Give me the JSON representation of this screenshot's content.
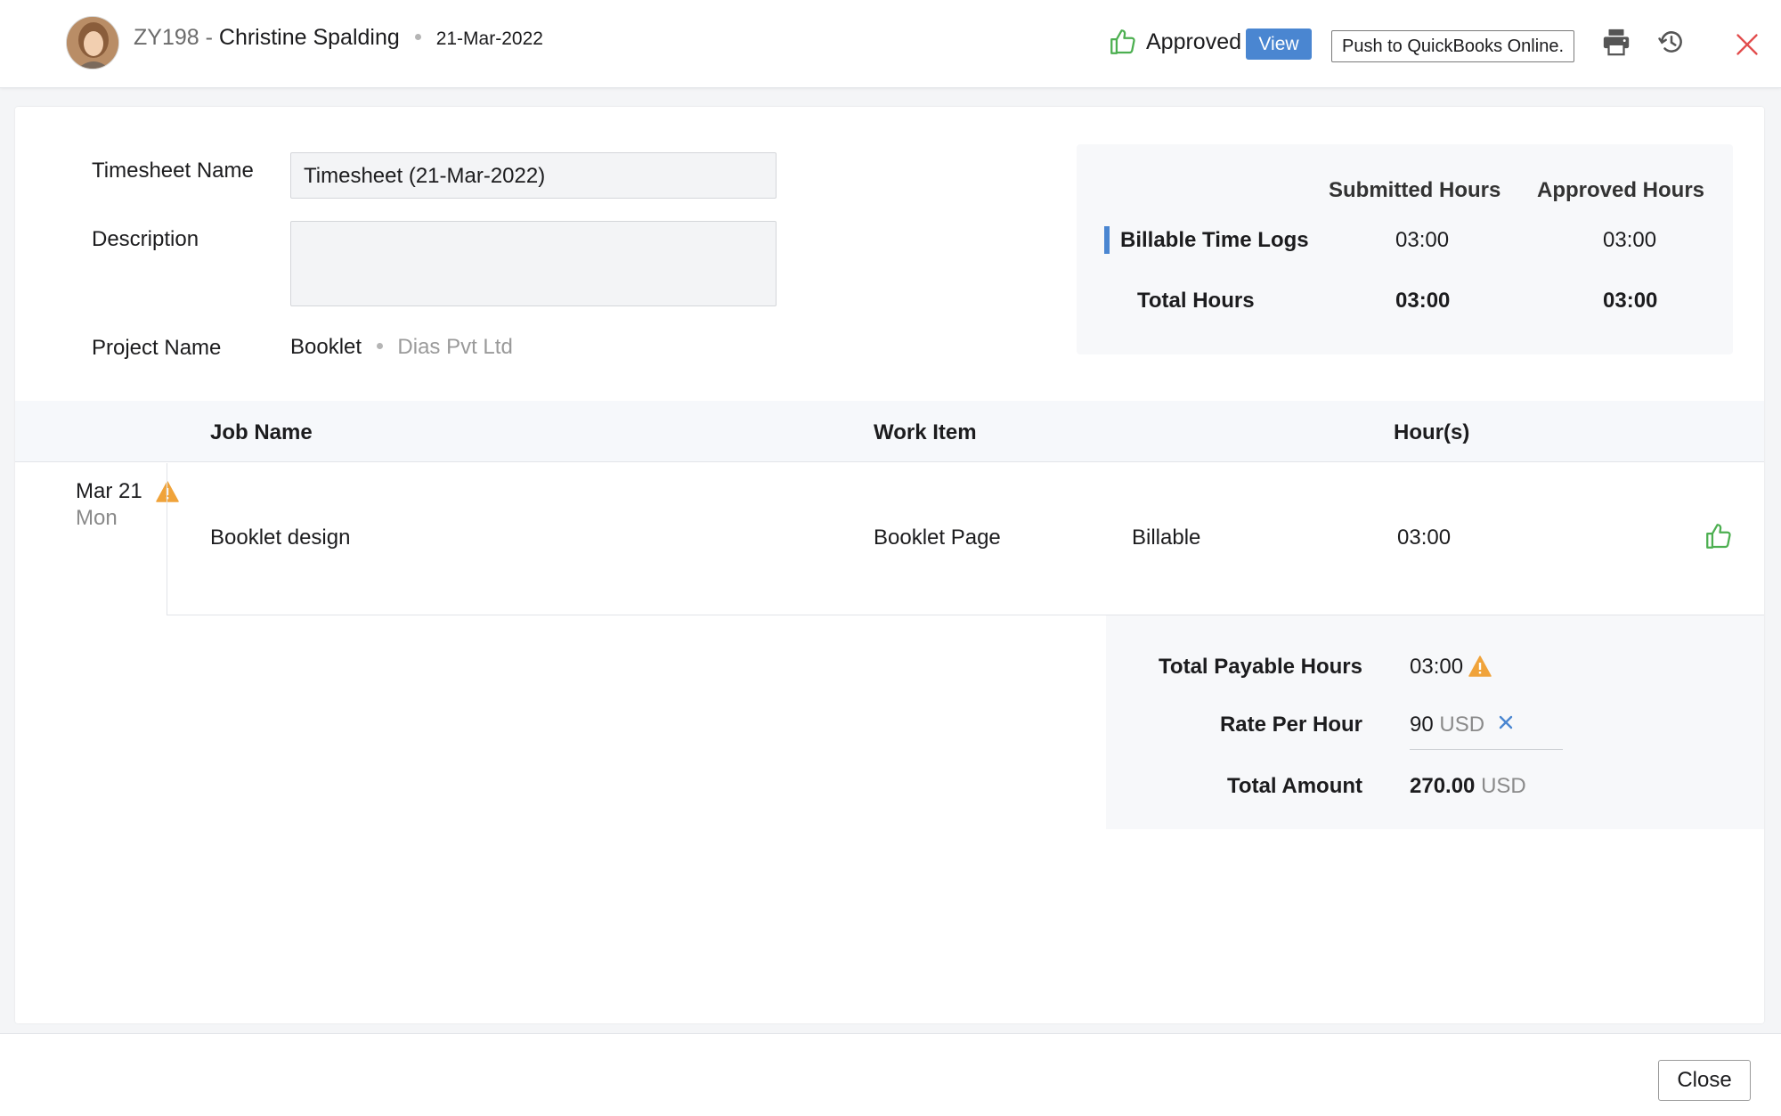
{
  "header": {
    "employee_code": "ZY198 -",
    "employee_name": "Christine Spalding",
    "date": "21-Mar-2022",
    "status": "Approved",
    "view_label": "View",
    "push_label": "Push to QuickBooks Online.",
    "icons": [
      "thumbs-up-icon",
      "print-icon",
      "history-icon",
      "close-icon"
    ],
    "colors": {
      "accent": "#4a86d1",
      "approved": "#4caf50",
      "close": "#e24c4c",
      "warning": "#f0a33a"
    }
  },
  "form": {
    "timesheet_name_label": "Timesheet Name",
    "timesheet_name_value": "Timesheet (21-Mar-2022)",
    "description_label": "Description",
    "description_value": "",
    "project_name_label": "Project Name",
    "project": "Booklet",
    "client": "Dias Pvt Ltd"
  },
  "summary": {
    "headers": {
      "submitted": "Submitted Hours",
      "approved": "Approved Hours"
    },
    "rows": [
      {
        "label": "Billable Time Logs",
        "submitted": "03:00",
        "approved": "03:00"
      },
      {
        "label": "Total Hours",
        "submitted": "03:00",
        "approved": "03:00"
      }
    ]
  },
  "table": {
    "headers": {
      "job": "Job Name",
      "work": "Work Item",
      "hours": "Hour(s)"
    },
    "rows": [
      {
        "date": "Mar 21",
        "day": "Mon",
        "job": "Booklet design",
        "work_item": "Booklet Page",
        "billing": "Billable",
        "hours": "03:00"
      }
    ]
  },
  "totals": {
    "payable_label": "Total Payable Hours",
    "payable_value": "03:00",
    "rate_label": "Rate Per Hour",
    "rate_value": "90",
    "rate_currency": "USD",
    "amount_label": "Total Amount",
    "amount_value": "270.00",
    "amount_currency": "USD"
  },
  "footer": {
    "close_label": "Close"
  }
}
